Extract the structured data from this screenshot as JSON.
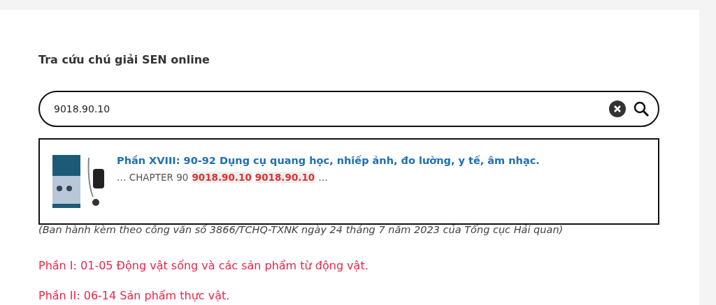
{
  "heading": "Tra cứu chú giải SEN online",
  "search": {
    "value": "9018.90.10"
  },
  "results": [
    {
      "kind": "picture",
      "title": "Phần XVIII: 90-92 Dụng cụ quang học, nhiếp ảnh, đo lường, y tế, âm nhạc.",
      "snippet": [
        {
          "text": "… CHAPTER 90",
          "highlight": false
        },
        {
          "text": "9018.90.10",
          "highlight": true
        },
        {
          "text": "9018.90.10",
          "highlight": true
        },
        {
          "text": "…",
          "highlight": false
        }
      ]
    }
  ],
  "note": "(Ban hành kèm theo công văn số 3866/TCHQ-TXNK ngày 24 tháng 7 năm 2023 của Tổng cục Hải quan)",
  "sections": [
    "Phần I: 01-05 Động vật sống và các sản phẩm từ động vật.",
    "Phần II: 06-14 Sản phẩm thực vật."
  ]
}
